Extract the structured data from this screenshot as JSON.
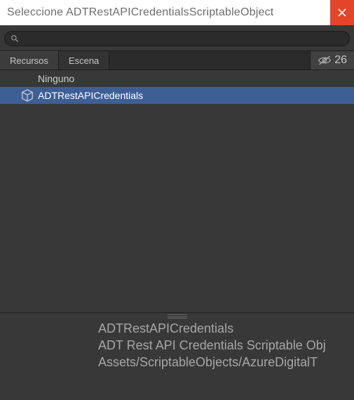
{
  "titlebar": {
    "title": "Seleccione  ADTRestAPICredentialsScriptableObject"
  },
  "search": {
    "value": "",
    "placeholder": ""
  },
  "tabs": {
    "items": [
      {
        "label": "Recursos"
      },
      {
        "label": "Escena"
      }
    ],
    "hidden_count": "26"
  },
  "list": {
    "none_label": "Ninguno",
    "items": [
      {
        "label": "ADTRestAPICredentials",
        "selected": true
      }
    ]
  },
  "detail": {
    "line1": "ADTRestAPICredentials",
    "line2": "ADT Rest API Credentials Scriptable Obj",
    "line3": "Assets/ScriptableObjects/AzureDigitalT"
  }
}
